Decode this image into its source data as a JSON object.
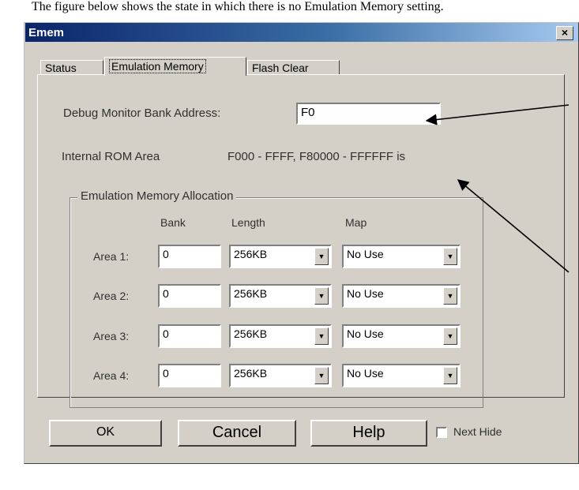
{
  "caption": "The figure below shows the state in which there is no Emulation Memory setting.",
  "window": {
    "title": "Emem",
    "close_icon": "close-icon"
  },
  "tabs": [
    {
      "label": "Status",
      "active": false
    },
    {
      "label": "Emulation Memory",
      "active": true
    },
    {
      "label": "Flash Clear",
      "active": false
    }
  ],
  "debug_monitor": {
    "label": "Debug Monitor Bank Address:",
    "value": "F0"
  },
  "internal_rom": {
    "label": "Internal ROM Area",
    "value": "F000 - FFFF, F80000 - FFFFFF is"
  },
  "allocation": {
    "group_label": "Emulation Memory Allocation",
    "headers": {
      "bank": "Bank",
      "length": "Length",
      "map": "Map"
    },
    "rows": [
      {
        "label": "Area 1:",
        "bank": "0",
        "length": "256KB",
        "map": "No Use"
      },
      {
        "label": "Area 2:",
        "bank": "0",
        "length": "256KB",
        "map": "No Use"
      },
      {
        "label": "Area 3:",
        "bank": "0",
        "length": "256KB",
        "map": "No Use"
      },
      {
        "label": "Area 4:",
        "bank": "0",
        "length": "256KB",
        "map": "No Use"
      }
    ]
  },
  "buttons": {
    "ok": "OK",
    "cancel": "Cancel",
    "help": "Help"
  },
  "next_hide": {
    "label": "Next Hide",
    "checked": false
  },
  "colors": {
    "titlebar_start": "#0a246a",
    "titlebar_end": "#a6caf0",
    "face": "#d4d0c8"
  }
}
